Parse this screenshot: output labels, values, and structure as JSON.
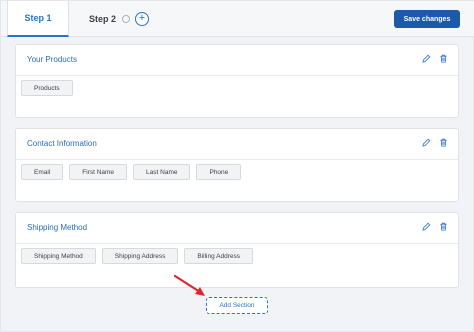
{
  "tabs": [
    {
      "label": "Step 1",
      "active": true
    },
    {
      "label": "Step 2",
      "active": false
    }
  ],
  "toolbar": {
    "save_label": "Save changes"
  },
  "sections": [
    {
      "title": "Your Products",
      "fields": [
        "Products"
      ]
    },
    {
      "title": "Contact Information",
      "fields": [
        "Email",
        "First Name",
        "Last Name",
        "Phone"
      ]
    },
    {
      "title": "Shipping Method",
      "fields": [
        "Shipping Method",
        "Shipping Address",
        "Billing Address"
      ]
    }
  ],
  "add_section_label": "Add Section",
  "colors": {
    "accent": "#2b72c8",
    "save_button": "#1a5aa8",
    "annotation_arrow": "#e0262a"
  },
  "icons": [
    "plus-circle-icon",
    "check-circle-icon",
    "edit-icon",
    "trash-icon",
    "arrow-annotation-icon"
  ]
}
